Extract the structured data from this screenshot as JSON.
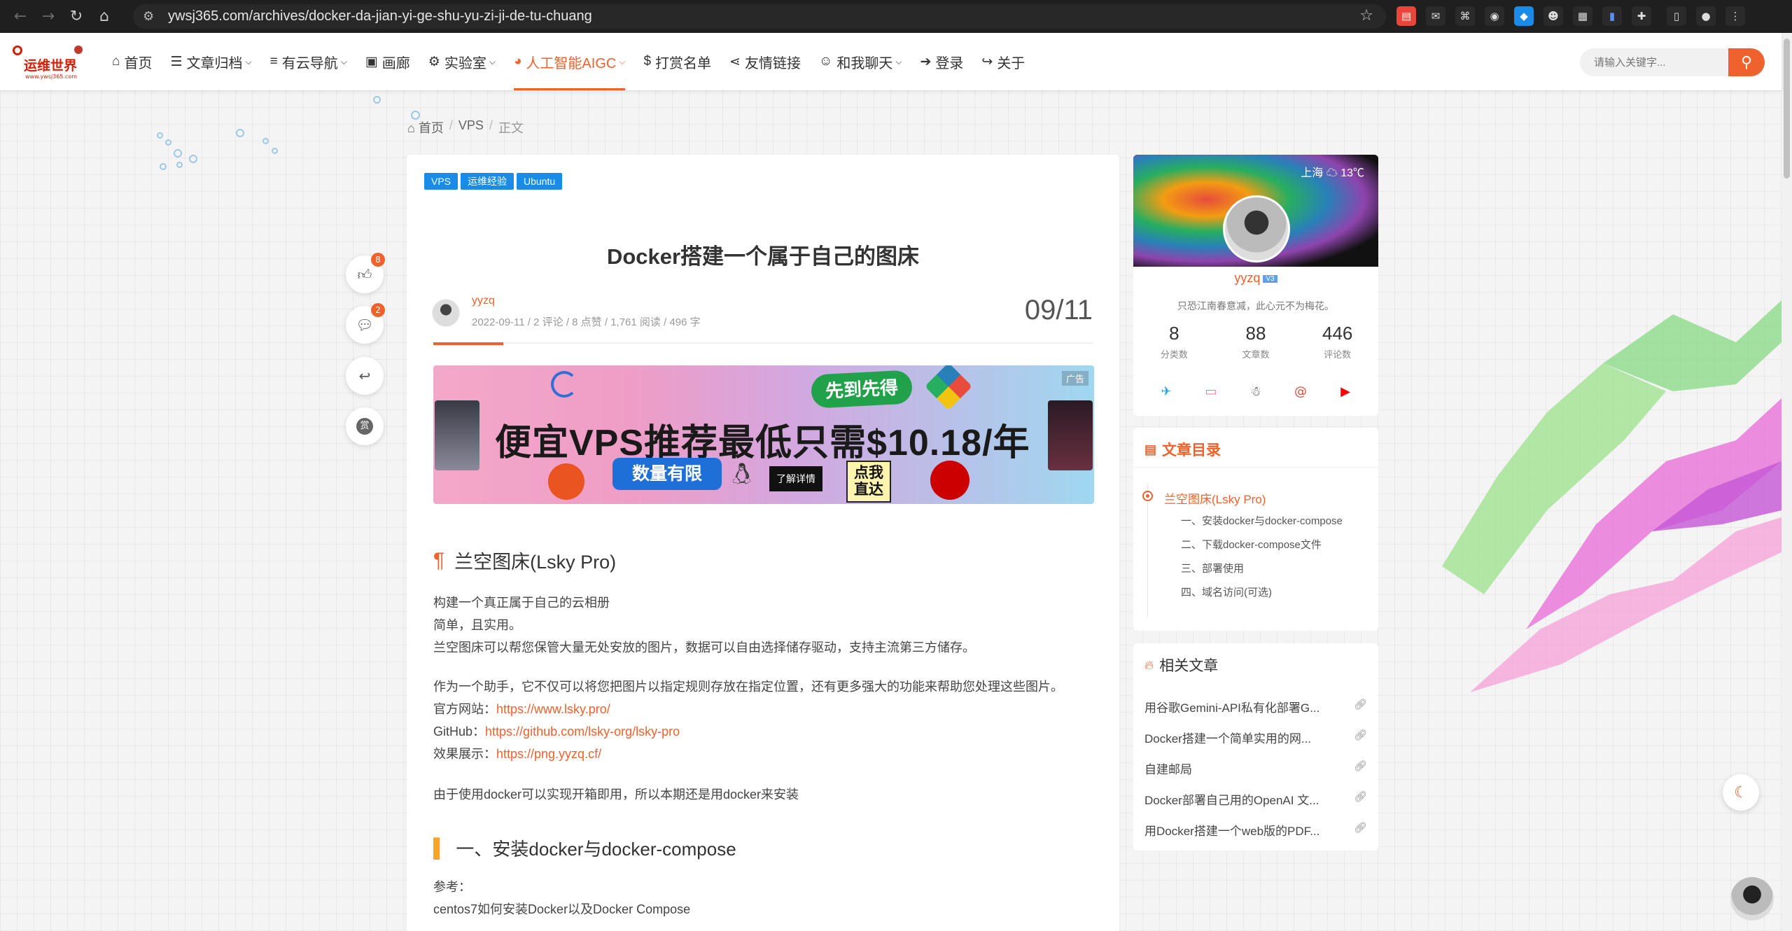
{
  "browser": {
    "url": "ywsj365.com/archives/docker-da-jian-yi-ge-shu-yu-zi-ji-de-tu-chuang"
  },
  "site": {
    "logo_text": "运维世界",
    "logo_sub": "www.ywsj365.com",
    "nav": [
      {
        "label": "首页",
        "icon": "home-icon"
      },
      {
        "label": "文章归档",
        "icon": "list-icon",
        "dropdown": true
      },
      {
        "label": "有云导航",
        "icon": "nav-list-icon",
        "dropdown": true
      },
      {
        "label": "画廊",
        "icon": "image-icon"
      },
      {
        "label": "实验室",
        "icon": "gear-icon",
        "dropdown": true
      },
      {
        "label": "人工智能AIGC",
        "icon": "chrome-icon",
        "dropdown": true,
        "active": true
      },
      {
        "label": "打赏名单",
        "icon": "dollar-icon"
      },
      {
        "label": "友情链接",
        "icon": "share-icon"
      },
      {
        "label": "和我聊天",
        "icon": "users-icon",
        "dropdown": true
      },
      {
        "label": "登录",
        "icon": "login-icon"
      },
      {
        "label": "关于",
        "icon": "share-arrow-icon"
      }
    ],
    "search_placeholder": "请输入关键字...",
    "accent": "#f0622d"
  },
  "breadcrumb": {
    "home": "首页",
    "category": "VPS",
    "current": "正文"
  },
  "article": {
    "tags": [
      "VPS",
      "运维经验",
      "Ubuntu"
    ],
    "title": "Docker搭建一个属于自己的图床",
    "author": "yyzq",
    "date": "2022-09-11",
    "comments": "2 评论",
    "likes": "8 点赞",
    "views": "1,761 阅读",
    "words": "496 字",
    "date_big": "09/11",
    "banner": {
      "ad_label": "广告",
      "headline": "便宜VPS推荐最低只需$10.18/年",
      "first_come": "先到先得",
      "limited": "数量有限",
      "details": "了解详情",
      "reach_1": "点我",
      "reach_2": "直达"
    },
    "h_lsky": "兰空图床(Lsky Pro)",
    "p1": "构建一个真正属于自己的云相册",
    "p2": "简单，且实用。",
    "p3": "兰空图床可以帮您保管大量无处安放的图片，数据可以自由选择储存驱动，支持主流第三方储存。",
    "p4": "作为一个助手，它不仅可以将您把图片以指定规则存放在指定位置，还有更多强大的功能来帮助您处理这些图片。",
    "site_label": "官方网站：",
    "site_url": "https://www.lsky.pro/",
    "github_label": "GitHub：",
    "github_url": "https://github.com/lsky-org/lsky-pro",
    "demo_label": "效果展示：",
    "demo_url": "https://png.yyzq.cf/",
    "p5": "由于使用docker可以实现开箱即用，所以本期还是用docker来安装",
    "h_install": "一、安装docker与docker-compose",
    "ref_label": "参考：",
    "ref_link": "centos7如何安装Docker以及Docker Compose"
  },
  "actions": {
    "like_count": "8",
    "comment_count": "2",
    "reward_label": "赏"
  },
  "sidebar": {
    "profile": {
      "weather": "上海 ☁ 13℃",
      "name": "yyzq",
      "level": "V3",
      "motto": "只恐江南春意减，此心元不为梅花。",
      "stats": [
        {
          "num": "8",
          "label": "分类数"
        },
        {
          "num": "88",
          "label": "文章数"
        },
        {
          "num": "446",
          "label": "评论数"
        }
      ]
    },
    "toc": {
      "title": "文章目录",
      "items": [
        "兰空图床(Lsky Pro)",
        "一、安装docker与docker-compose",
        "二、下载docker-compose文件",
        "三、部署使用",
        "四、域名访问(可选)"
      ]
    },
    "related": {
      "title": "相关文章",
      "items": [
        "用谷歌Gemini-API私有化部署G...",
        "Docker搭建一个简单实用的网...",
        "自建邮局",
        "Docker部署自己用的OpenAI 文...",
        "用Docker搭建一个web版的PDF..."
      ]
    }
  }
}
